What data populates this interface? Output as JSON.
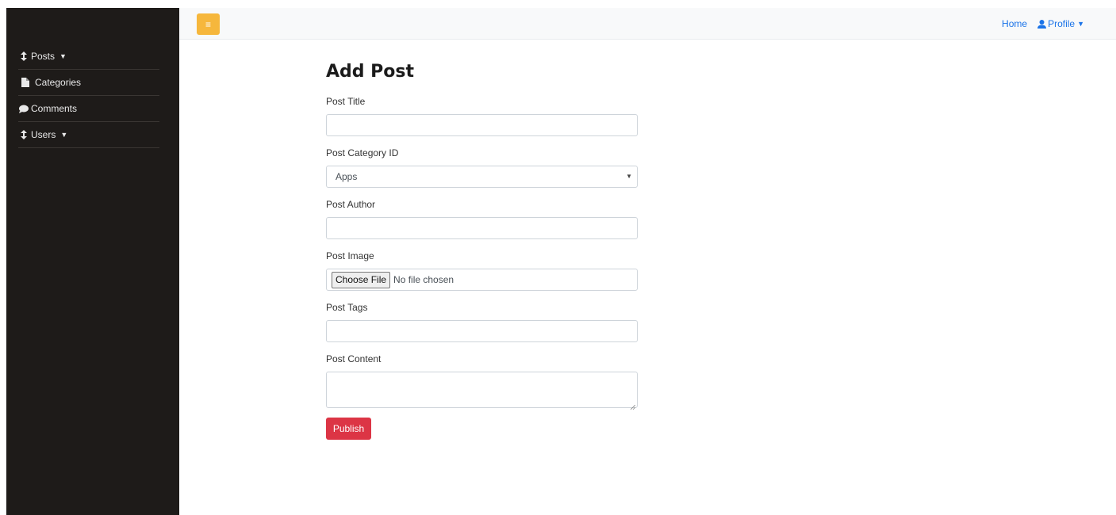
{
  "sidebar": {
    "items": [
      {
        "label": "Posts",
        "icon": "sort-icon",
        "has_caret": true
      },
      {
        "label": "Categories",
        "icon": "file-icon",
        "has_caret": false
      },
      {
        "label": "Comments",
        "icon": "comment-icon",
        "has_caret": false
      },
      {
        "label": "Users",
        "icon": "sort-icon",
        "has_caret": true
      }
    ]
  },
  "topnav": {
    "toggle_icon": "menu-icon",
    "home_label": "Home",
    "profile_label": "Profile",
    "profile_icon": "user-icon"
  },
  "page": {
    "title": "Add Post"
  },
  "form": {
    "post_title": {
      "label": "Post Title",
      "value": ""
    },
    "post_category": {
      "label": "Post Category ID",
      "selected": "Apps"
    },
    "post_author": {
      "label": "Post Author",
      "value": ""
    },
    "post_image": {
      "label": "Post Image",
      "button_label": "Choose File",
      "status": "No file chosen"
    },
    "post_tags": {
      "label": "Post Tags",
      "value": ""
    },
    "post_content": {
      "label": "Post Content",
      "value": ""
    },
    "submit_label": "Publish"
  },
  "colors": {
    "sidebar_bg": "#1e1b19",
    "toggle_bg": "#f6b73c",
    "link": "#1a73e8",
    "publish_bg": "#dc3545"
  }
}
